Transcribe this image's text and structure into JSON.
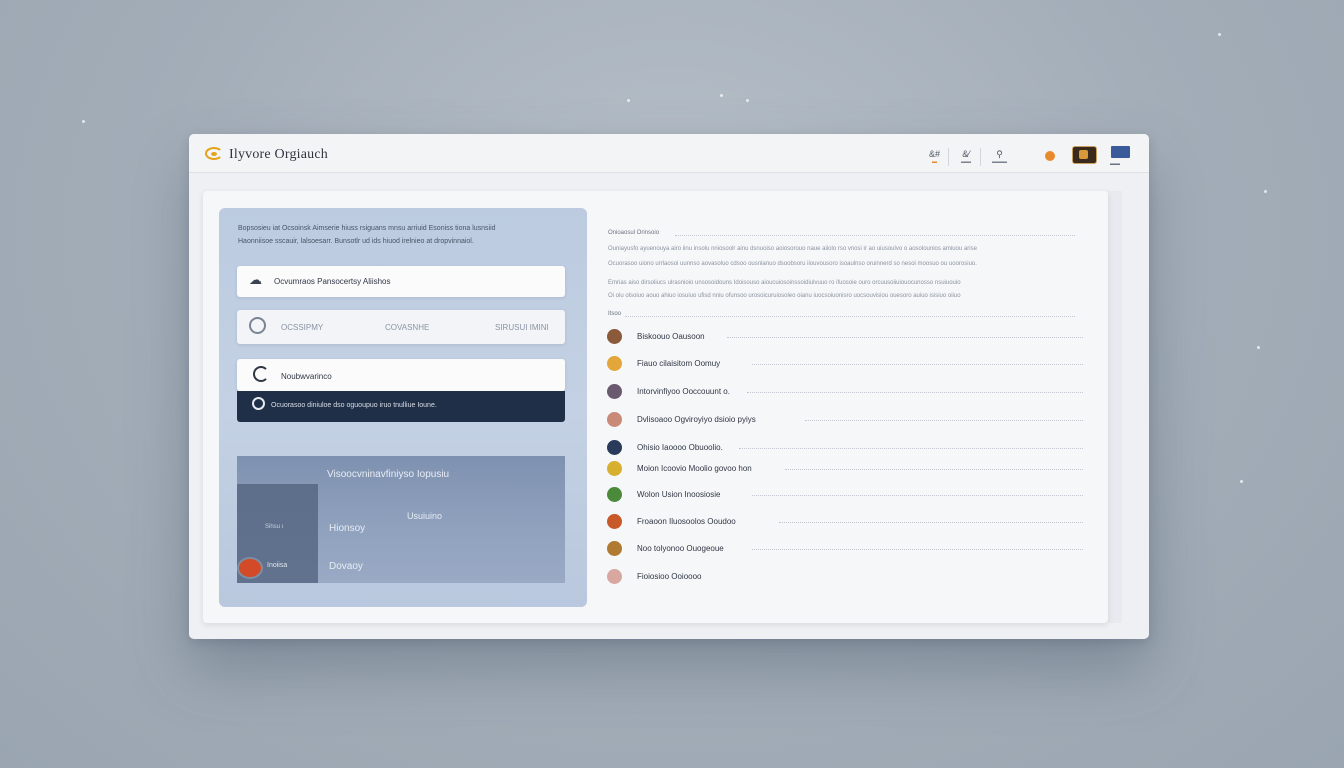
{
  "app": {
    "title": "Ilyvore Orgiauch",
    "toolbar": [
      {
        "glyph": "&#",
        "label": "▬"
      },
      {
        "glyph": "&⁄",
        "label": "▬▬"
      },
      {
        "glyph": "⚲",
        "label": "▬▬▬"
      }
    ],
    "flag_label": "▬▬"
  },
  "left": {
    "intro": "Bopsosieu iat Ocsoinsk Aimserie hiuss rsiguans mnsu arriuid Esoniss tiona lusnsiid Haonniisoe sscauir, lalsoesarr. Bunsotlr ud ids hiuod irelnieo at dropvinnaiol.",
    "field1_text": "Ocvumraos Pansocertsy Aliishos",
    "field2_left": "OCSSIPMY",
    "field2_mid": "COVASNHE",
    "field2_right": "SIRUSUI IMINI",
    "field3_text": "Noubwvarinco",
    "dark_bar_text": "Ocuorasoo diniuloe dso oguoupuo iruo tnulliue Ioune.",
    "media_title": "Visoocvninavfiniyso Iopusiu",
    "media_sub1": "Usuiuino",
    "media_sub2": "Hionsoy",
    "media_sub3": "Dovaoy",
    "media_side1": "Sihsu ı",
    "media_side2": "Inoiisa"
  },
  "right": {
    "heading": "Onioaosul Orinsoio",
    "desc1": "Ouniayusfo ayuenouya airo iinu insolu nniosoolr ainu dsnuoiso aoiosorouo naue aiiolo rso vnosi ir ao uiusoulvo o aosolounios amiuou arise",
    "desc2": "Ocuorasoo uiono urrlaosoi uunnso aovasoluo cdsoo ousnlanuo dsoobsoru iiouvousoro isoaulnso oruinnerd so nesoi moosuo ou uoorosiuo.",
    "desc3": "Emrias aiso dirsoliucs ulrasnioio unsosoidouns Idoisouso aioucuiosoinssoidiulvuuo ro ifuosoie ouro orcuusoiiuiouocunosso nsuiuouio",
    "desc4": "Oi oiu olsoiuo aouo ahiuo iosuiuo ufisd nniu ofunsoo urosoicuruiosoleo oianu iuocsoiuonisro uocsouvisiou ouesoro auiuo isisiuo oiiuo",
    "list_label": "Itsoo",
    "items": [
      {
        "label": "Biskoouo Oausoon",
        "color": "#8a5a3a"
      },
      {
        "label": "Fiauo cilaisitom Oomuy",
        "color": "#e2a63a"
      },
      {
        "label": "Intorvinfiyoo Ooccouunt o.",
        "color": "#6a5a70"
      },
      {
        "label": "Dvlisoaoo Ogviroyiyo dsioio pyiys",
        "color": "#c98a78"
      },
      {
        "label": "Ohisio Iaoooo Obuoolio.",
        "color": "#2a3a5a"
      },
      {
        "label": "Moion Icoovio Moolio  govoo hon",
        "color": "#d8b030"
      },
      {
        "label": "Wolon Usion Inoosiosie",
        "color": "#4a8a3a"
      },
      {
        "label": "Froaoon Iluosoolos Ooudoo",
        "color": "#c85a2a"
      },
      {
        "label": "Noo tolyonoo Ouogeoue",
        "color": "#b07a30"
      },
      {
        "label": "Fioiosioo Ooioooo",
        "color": "#d8a8a0"
      }
    ]
  },
  "colors": {
    "accent_orange": "#e4a41a",
    "dark_bar": "#1f2f48",
    "panel_blue": "#bccbe0"
  }
}
